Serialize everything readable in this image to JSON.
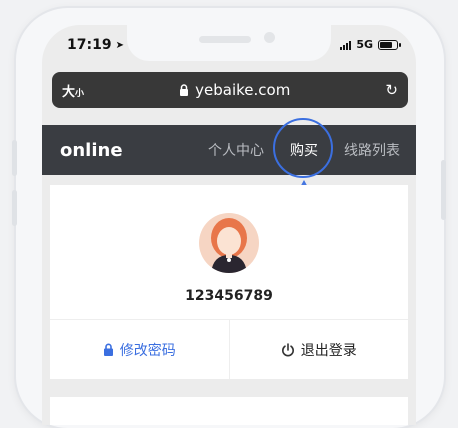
{
  "status_bar": {
    "time": "17:19",
    "network": "5G"
  },
  "browser": {
    "text_size_label": "大",
    "text_size_small": "小",
    "url": "yebaike.com"
  },
  "nav": {
    "brand": "online",
    "items": [
      {
        "label": "个人中心",
        "active": false
      },
      {
        "label": "购买",
        "active": true
      },
      {
        "label": "线路列表",
        "active": false
      }
    ]
  },
  "profile": {
    "user_id": "123456789"
  },
  "actions": {
    "change_password": "修改密码",
    "logout": "退出登录"
  },
  "colors": {
    "accent": "#3b6fe0",
    "nav_bg": "#3a3d42",
    "url_bg": "#383838"
  }
}
